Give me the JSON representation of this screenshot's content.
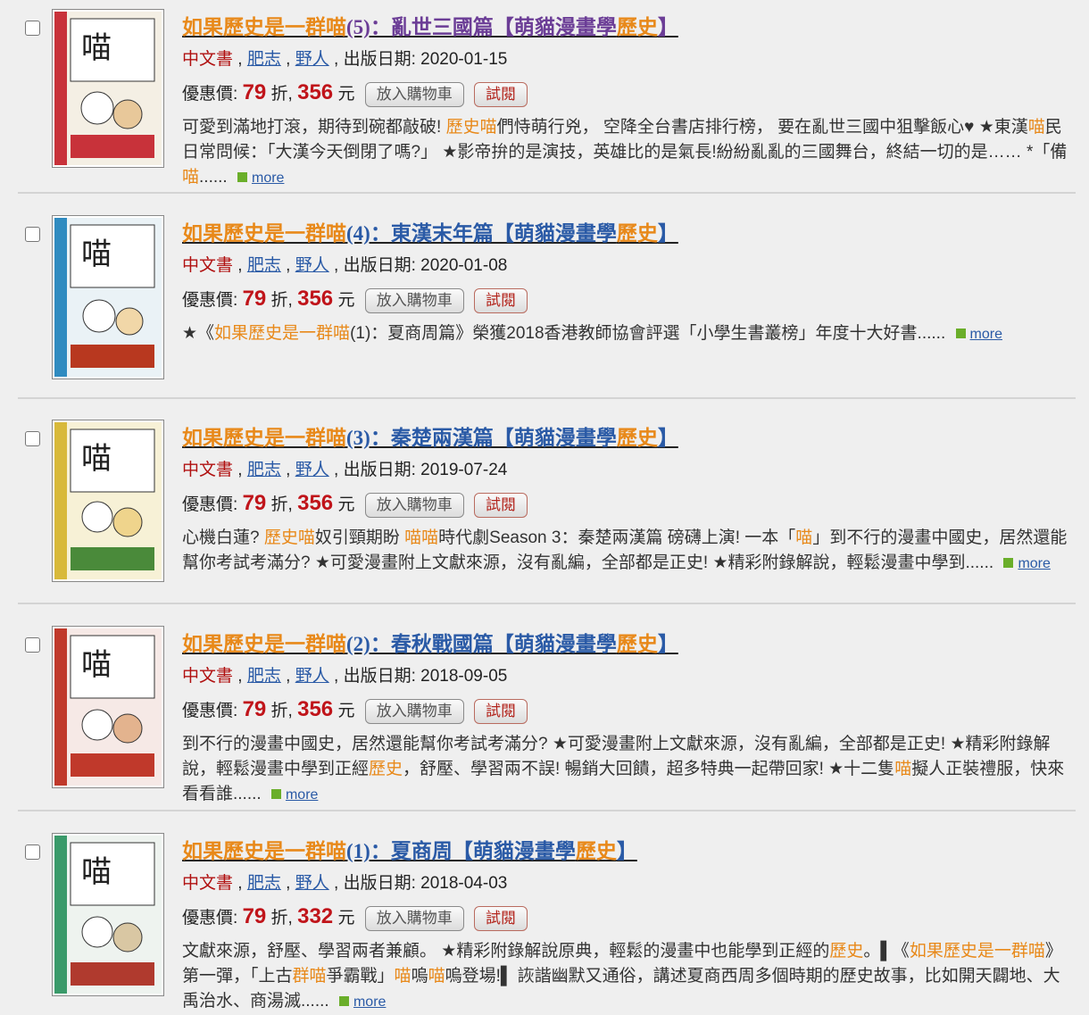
{
  "labels": {
    "lang": "中文書",
    "publisher": "野人",
    "author": "肥志",
    "date_prefix": "出版日期: ",
    "price_prefix": "優惠價: ",
    "discount_unit": "折,",
    "currency": "元",
    "cart_button": "放入購物車",
    "try_button": "試閱",
    "more": "more",
    "sep": ","
  },
  "items": [
    {
      "title_a": "如果歷史是一群喵",
      "title_b": "(5)：亂世三國篇【萌貓漫畫學",
      "title_c": "歷史",
      "title_d": "】",
      "date": "2020-01-15",
      "discount": "79",
      "price": "356",
      "desc": [
        {
          "t": "可愛到滿地打滾，期待到碗都敲破! ",
          "h": false
        },
        {
          "t": "歷史喵",
          "h": true
        },
        {
          "t": "們恃萌行兇， 空降全台書店排行榜， 要在亂世三國中狙擊飯心♥ ★東漢",
          "h": false
        },
        {
          "t": "喵",
          "h": true
        },
        {
          "t": "民日常問候：「大漢今天倒閉了嗎?」 ★影帝拚的是演技，英雄比的是氣長!紛紛亂亂的三國舞台，終結一切的是…… *「備",
          "h": false
        },
        {
          "t": "喵",
          "h": true
        },
        {
          "t": "......",
          "h": false
        }
      ],
      "cover_color": "#c8323a"
    },
    {
      "title_a": "如果歷史是一群喵",
      "title_b": "(4)：東漢末年篇【萌貓漫畫學",
      "title_c": "歷史",
      "title_d": "】",
      "date": "2020-01-08",
      "discount": "79",
      "price": "356",
      "desc": [
        {
          "t": "★《",
          "h": false
        },
        {
          "t": "如果歷史是一群喵",
          "h": true
        },
        {
          "t": "(1)：夏商周篇》榮獲2018香港教師協會評選「小學生書叢榜」年度十大好書......",
          "h": false
        }
      ],
      "cover_color": "#2f8bc0"
    },
    {
      "title_a": "如果歷史是一群喵",
      "title_b": "(3)：秦楚兩漢篇【萌貓漫畫學",
      "title_c": "歷史",
      "title_d": "】",
      "date": "2019-07-24",
      "discount": "79",
      "price": "356",
      "desc": [
        {
          "t": "心機白蓮? ",
          "h": false
        },
        {
          "t": "歷史喵",
          "h": true
        },
        {
          "t": "奴引頸期盼 ",
          "h": false
        },
        {
          "t": "喵喵",
          "h": true
        },
        {
          "t": "時代劇Season 3：秦楚兩漢篇 磅礴上演! 一本「",
          "h": false
        },
        {
          "t": "喵",
          "h": true
        },
        {
          "t": "」到不行的漫畫中國史，居然還能幫你考試考滿分? ★可愛漫畫附上文獻來源，沒有亂編，全部都是正史! ★精彩附錄解說，輕鬆漫畫中學到......",
          "h": false
        }
      ],
      "cover_color": "#d8b93a"
    },
    {
      "title_a": "如果歷史是一群喵",
      "title_b": "(2)：春秋戰國篇【萌貓漫畫學",
      "title_c": "歷史",
      "title_d": "】",
      "date": "2018-09-05",
      "discount": "79",
      "price": "356",
      "desc": [
        {
          "t": "到不行的漫畫中國史，居然還能幫你考試考滿分? ★可愛漫畫附上文獻來源，沒有亂編，全部都是正史! ★精彩附錄解說，輕鬆漫畫中學到正經",
          "h": false
        },
        {
          "t": "歷史",
          "h": true
        },
        {
          "t": "，舒壓、學習兩不誤! 暢銷大回饋，超多特典一起帶回家! ★十二隻",
          "h": false
        },
        {
          "t": "喵",
          "h": true
        },
        {
          "t": "擬人正裝禮服，快來看看誰......",
          "h": false
        }
      ],
      "cover_color": "#c0392b"
    },
    {
      "title_a": "如果歷史是一群喵",
      "title_b": "(1)：夏商周【萌貓漫畫學",
      "title_c": "歷史",
      "title_d": "】",
      "date": "2018-04-03",
      "discount": "79",
      "price": "332",
      "desc": [
        {
          "t": "文獻來源，舒壓、學習兩者兼顧。 ★精彩附錄解說原典，輕鬆的漫畫中也能學到正經的",
          "h": false
        },
        {
          "t": "歷史",
          "h": true
        },
        {
          "t": "。▌《",
          "h": false
        },
        {
          "t": "如果歷史是一群喵",
          "h": true
        },
        {
          "t": "》第一彈，「上古",
          "h": false
        },
        {
          "t": "群喵",
          "h": true
        },
        {
          "t": "爭霸戰」",
          "h": false
        },
        {
          "t": "喵",
          "h": true
        },
        {
          "t": "嗚",
          "h": false
        },
        {
          "t": "喵",
          "h": true
        },
        {
          "t": "嗚登場!▌ 詼諧幽默又通俗，講述夏商西周多個時期的歷史故事，比如開天闢地、大禹治水、商湯滅......",
          "h": false
        }
      ],
      "cover_color": "#3a9a6a"
    }
  ]
}
